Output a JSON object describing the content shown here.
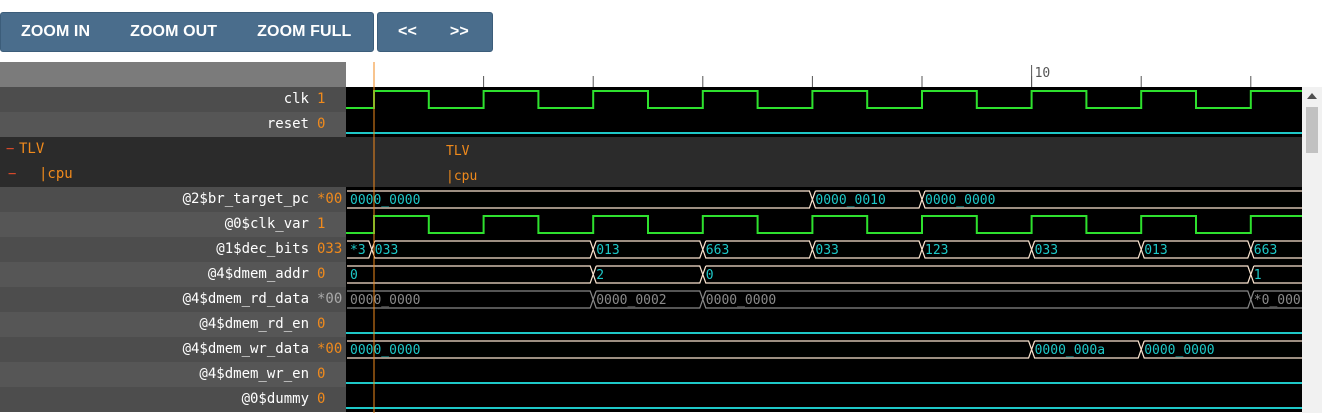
{
  "toolbar": {
    "zoom_in": "ZOOM IN",
    "zoom_out": "ZOOM OUT",
    "zoom_full": "ZOOM FULL",
    "prev": "<<",
    "next": ">>"
  },
  "timeline": {
    "tick_label": "10"
  },
  "colors": {
    "accent_orange": "#f08a1c",
    "wave_green": "#2ee02e",
    "wave_cyan": "#1ec8c8",
    "bus_border": "#fbe4d0",
    "toolbar_button": "#4a6d8c"
  },
  "signals": [
    {
      "name": "clk",
      "value": "1",
      "kind": "clock"
    },
    {
      "name": "reset",
      "value": "0",
      "kind": "low"
    },
    {
      "name": "TLV",
      "kind": "scope",
      "prefix": "−",
      "wave_label": "TLV"
    },
    {
      "name": "|cpu",
      "kind": "scope",
      "prefix": "−",
      "wave_label": "|cpu"
    },
    {
      "name": "@2$br_target_pc",
      "value": "*00",
      "kind": "bus",
      "segments": [
        {
          "label": "0000_0000"
        },
        {
          "label": "0000_0010"
        },
        {
          "label": "0000_0000"
        }
      ]
    },
    {
      "name": "@0$clk_var",
      "value": "1",
      "kind": "clock"
    },
    {
      "name": "@1$dec_bits",
      "value": "033",
      "kind": "bus",
      "segments": [
        {
          "label": "*3"
        },
        {
          "label": "033"
        },
        {
          "label": "013"
        },
        {
          "label": "663"
        },
        {
          "label": "033"
        },
        {
          "label": "123"
        },
        {
          "label": "033"
        },
        {
          "label": "013"
        },
        {
          "label": "663"
        }
      ]
    },
    {
      "name": "@4$dmem_addr",
      "value": "0",
      "kind": "bus",
      "segments": [
        {
          "label": "0"
        },
        {
          "label": "2"
        },
        {
          "label": "0"
        },
        {
          "label": "1"
        }
      ]
    },
    {
      "name": "@4$dmem_rd_data",
      "value": "*00",
      "kind": "bus_dim",
      "dim": true,
      "segments": [
        {
          "label": "0000_0000"
        },
        {
          "label": "0000_0002"
        },
        {
          "label": "0000_0000"
        },
        {
          "label": "*0_000"
        }
      ]
    },
    {
      "name": "@4$dmem_rd_en",
      "value": "0",
      "kind": "low"
    },
    {
      "name": "@4$dmem_wr_data",
      "value": "*00",
      "kind": "bus",
      "segments": [
        {
          "label": "0000_0000"
        },
        {
          "label": "0000_000a"
        },
        {
          "label": "0000_0000"
        }
      ]
    },
    {
      "name": "@4$dmem_wr_en",
      "value": "0",
      "kind": "low"
    },
    {
      "name": "@0$dummy",
      "value": "0",
      "kind": "low"
    }
  ]
}
